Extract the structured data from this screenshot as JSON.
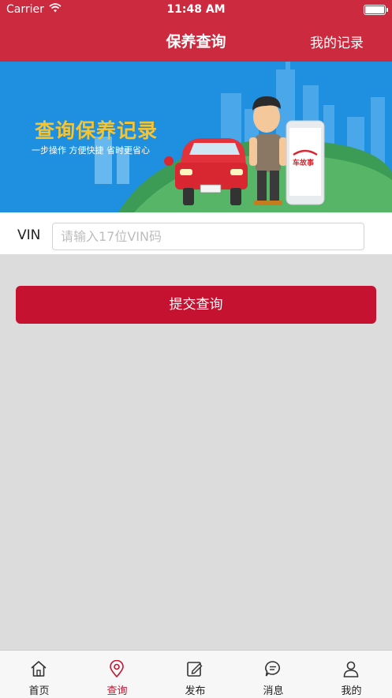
{
  "status_bar": {
    "carrier": "Carrier",
    "time": "11:48 AM"
  },
  "nav": {
    "title": "保养查询",
    "right_action": "我的记录"
  },
  "banner": {
    "title": "查询保养记录",
    "subtitle": "一步操作 方便快捷 省时更省心",
    "phone_logo": "车故事"
  },
  "form": {
    "vin_label": "VIN",
    "vin_placeholder": "请输入17位VIN码",
    "vin_value": ""
  },
  "submit_label": "提交查询",
  "tabs": [
    {
      "label": "首页",
      "icon": "home-icon",
      "active": false
    },
    {
      "label": "查询",
      "icon": "location-pin-icon",
      "active": true
    },
    {
      "label": "发布",
      "icon": "edit-icon",
      "active": false
    },
    {
      "label": "消息",
      "icon": "message-icon",
      "active": false
    },
    {
      "label": "我的",
      "icon": "user-icon",
      "active": false
    }
  ],
  "colors": {
    "header": "#cc2b3f",
    "accent": "#c41230",
    "background": "#dcdcdc",
    "banner_bg": "#1f8fe0",
    "banner_title": "#f6c431"
  }
}
